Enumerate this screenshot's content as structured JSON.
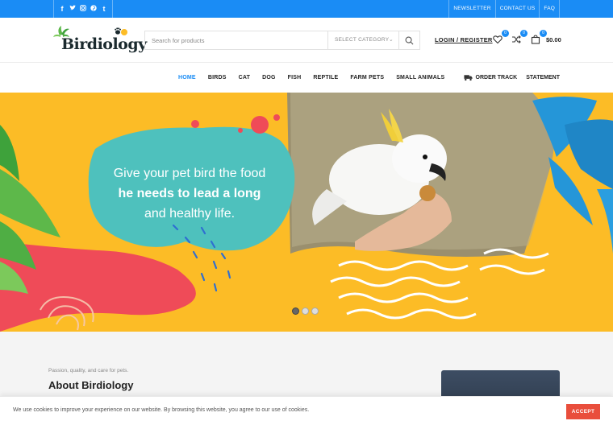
{
  "topbar": {
    "social_icons": [
      {
        "name": "facebook-icon",
        "glyph": "f"
      },
      {
        "name": "twitter-icon",
        "glyph": "t"
      },
      {
        "name": "instagram-icon",
        "glyph": "◎"
      },
      {
        "name": "pinterest-icon",
        "glyph": "p"
      },
      {
        "name": "tumblr-icon",
        "glyph": "t"
      }
    ],
    "links": [
      "NEWSLETTER",
      "CONTACT US",
      "FAQ"
    ]
  },
  "header": {
    "logo_text": "Birdiology",
    "search": {
      "placeholder": "Search for products",
      "category": "SELECT CATEGORY"
    },
    "login_label": "LOGIN / REGISTER",
    "wishlist_count": "0",
    "compare_count": "0",
    "cart_count": "0",
    "cart_total": "$0.00"
  },
  "nav": {
    "items": [
      "HOME",
      "BIRDS",
      "CAT",
      "DOG",
      "FISH",
      "REPTILE",
      "FARM PETS",
      "SMALL ANIMALS"
    ],
    "active": "HOME",
    "order_track": "ORDER TRACK",
    "statement": "STATEMENT"
  },
  "hero": {
    "line1": "Give your pet bird the food",
    "line2": "he needs to lead a long",
    "line3": "and healthy life.",
    "slides": 3,
    "active_slide": 1
  },
  "about": {
    "kicker": "Passion, quality, and care for pets.",
    "title": "About Birdiology"
  },
  "cookie": {
    "text": "We use cookies to improve your experience on our website. By browsing this website, you agree to our use of cookies.",
    "accept": "ACCEPT"
  },
  "colors": {
    "accent": "#1a8cf5",
    "hero_bg": "#fcbc26",
    "hero_teal": "#4ec1bd",
    "accept": "#e94e3c"
  }
}
